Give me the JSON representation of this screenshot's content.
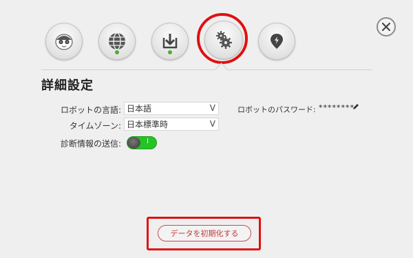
{
  "nav": {
    "items": [
      {
        "name": "robot-face",
        "icon": "robot-face-icon",
        "active": false,
        "status_dot": false
      },
      {
        "name": "network",
        "icon": "globe-icon",
        "active": false,
        "status_dot": true
      },
      {
        "name": "update",
        "icon": "download-icon",
        "active": false,
        "status_dot": true
      },
      {
        "name": "settings",
        "icon": "gears-icon",
        "active": true,
        "status_dot": false
      },
      {
        "name": "location",
        "icon": "location-pin-icon",
        "active": false,
        "status_dot": false
      }
    ],
    "close_icon": "close-icon"
  },
  "settings": {
    "title": "詳細設定",
    "language_label": "ロボットの言語:",
    "language_value": "日本語",
    "timezone_label": "タイムゾーン:",
    "timezone_value": "日本標準時",
    "diagnostics_label": "診断情報の送信:",
    "diagnostics_enabled": true,
    "diagnostics_toggle_mark": "I",
    "password_label": "ロボットのパスワード:",
    "password_value": "********",
    "dropdown_chevron": "V"
  },
  "actions": {
    "reset_label": "データを初期化する"
  },
  "colors": {
    "background": "#efefef",
    "highlight": "#e01010",
    "status_green": "#4caf2a",
    "toggle_on": "#24c424",
    "reset_text": "#c23a3a"
  }
}
